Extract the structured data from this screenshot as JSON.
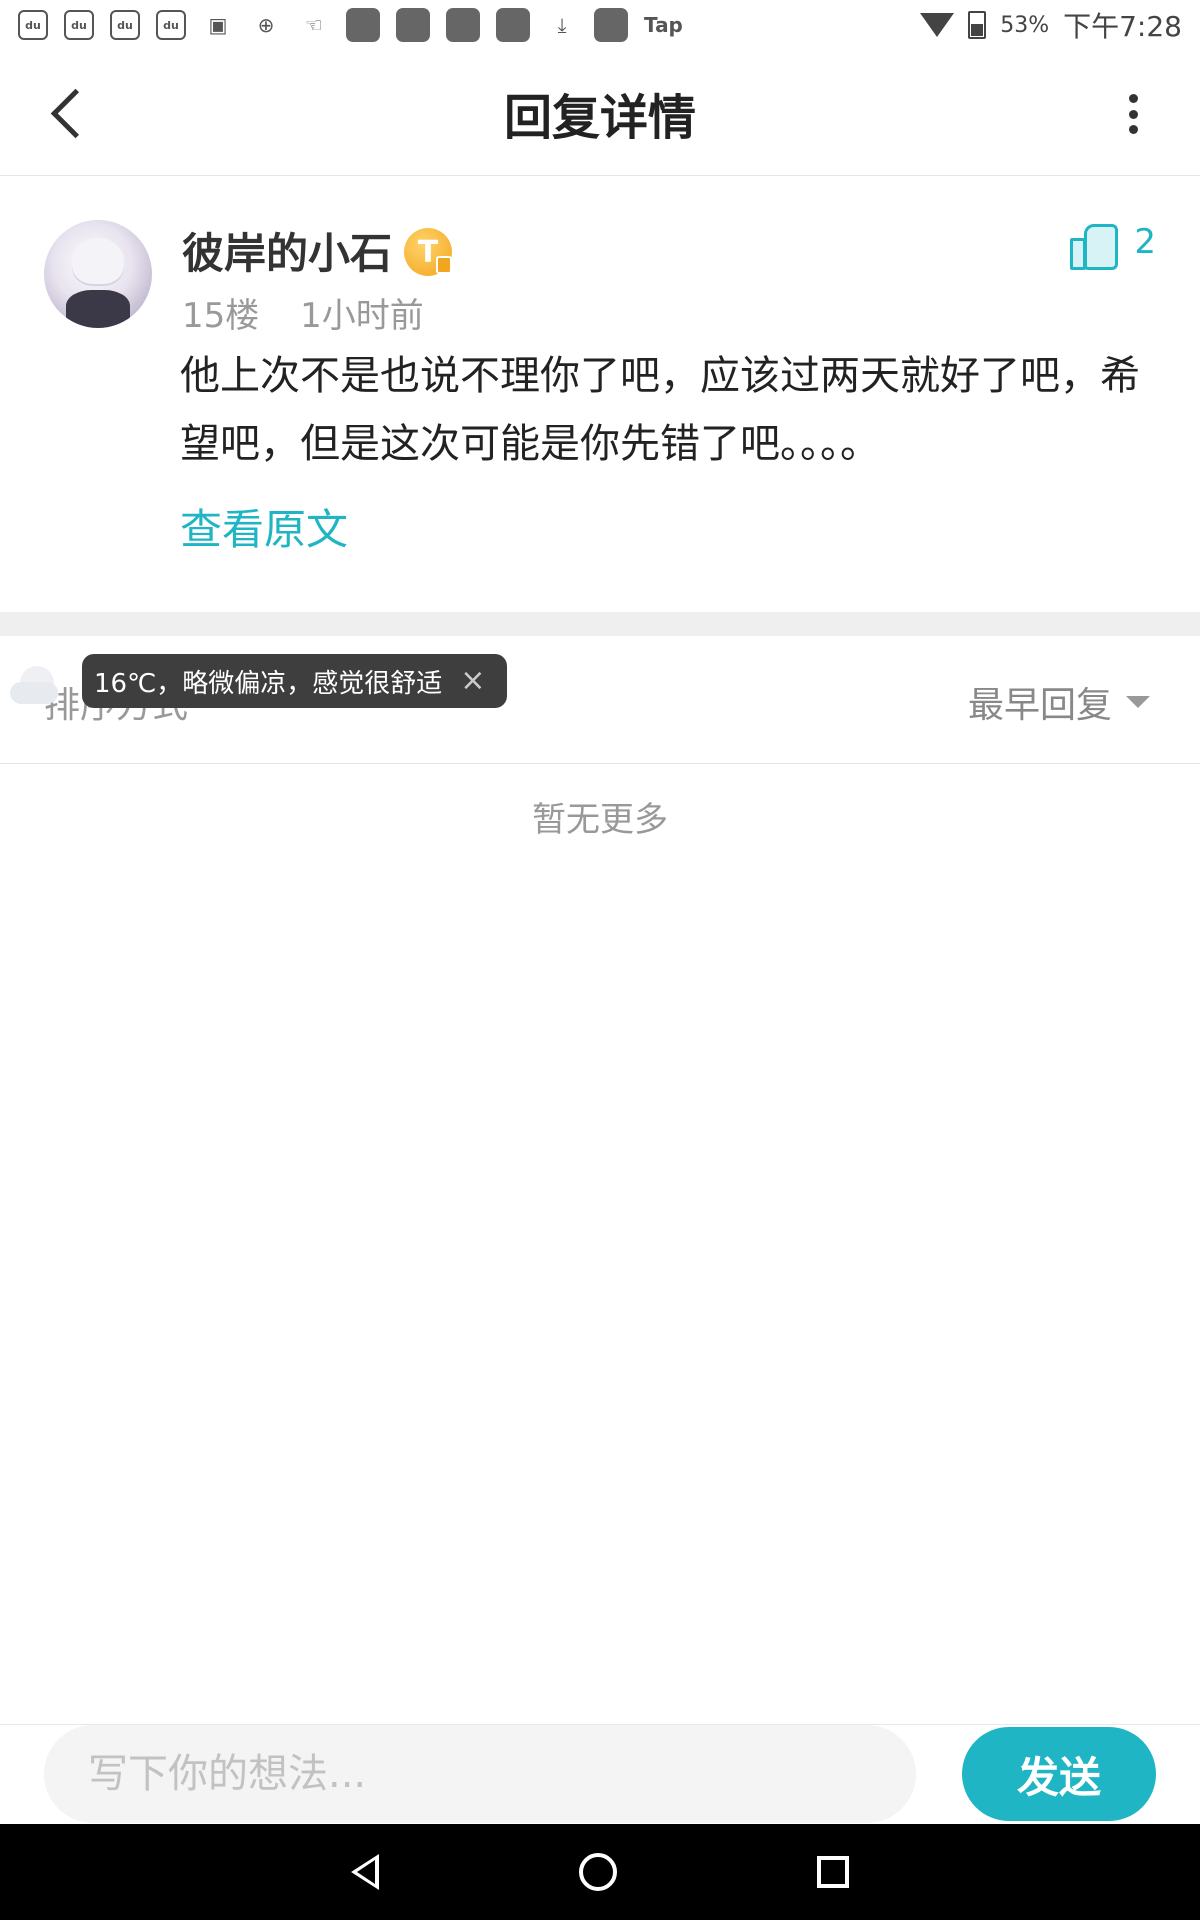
{
  "status_bar": {
    "tap_label": "Tap",
    "battery": "53%",
    "time": "下午7:28"
  },
  "header": {
    "title": "回复详情"
  },
  "post": {
    "username": "彼岸的小石",
    "badge": "T",
    "floor": "15楼",
    "time_ago": "1小时前",
    "content": "他上次不是也说不理你了吧，应该过两天就好了吧，希望吧，但是这次可能是你先错了吧。。。。",
    "view_original": "查看原文",
    "like_count": "2"
  },
  "sort": {
    "label": "排序方式",
    "selected": "最早回复"
  },
  "weather_toast": {
    "text": "16℃，略微偏凉，感觉很舒适",
    "close": "×"
  },
  "empty": {
    "text": "暂无更多"
  },
  "reply_bar": {
    "placeholder": "写下你的想法...",
    "send_label": "发送"
  },
  "colors": {
    "accent": "#1fb5c4",
    "badge": "#f2a51f"
  }
}
